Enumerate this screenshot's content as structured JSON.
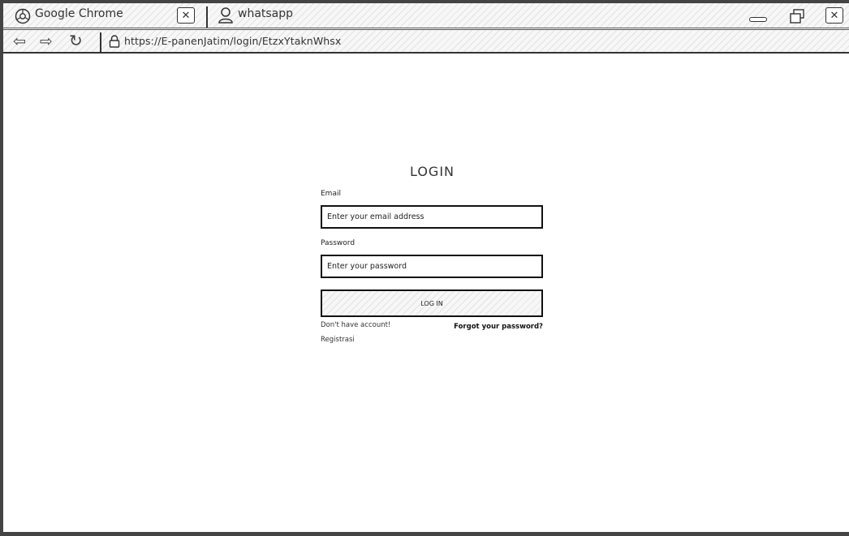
{
  "browser": {
    "app_title": "Google Chrome",
    "tab_title": "whatsapp",
    "url": "https://E-panenJatim/login/EtzxYtaknWhsx"
  },
  "login": {
    "title": "LOGIN",
    "email_label": "Email",
    "email_placeholder": "Enter your email address",
    "password_label": "Password",
    "password_placeholder": "Enter your password",
    "submit_label": "LOG IN",
    "no_account_text": "Don't have account!",
    "forgot_link": "Forgot your password?",
    "register_link": "Registrasi"
  }
}
